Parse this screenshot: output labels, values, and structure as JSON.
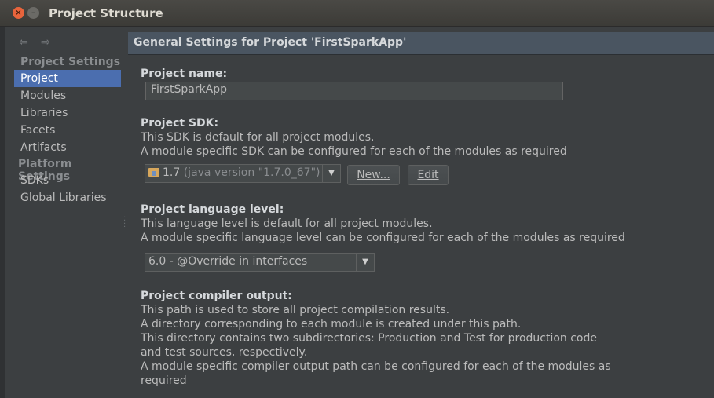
{
  "window": {
    "title": "Project Structure",
    "close_glyph": "×",
    "maximize_glyph": "–"
  },
  "sidebar": {
    "back_arrow": "⇦",
    "forward_arrow": "⇨",
    "section_project": "Project Settings",
    "items_project": [
      {
        "label": "Project",
        "selected": true
      },
      {
        "label": "Modules"
      },
      {
        "label": "Libraries"
      },
      {
        "label": "Facets"
      },
      {
        "label": "Artifacts"
      }
    ],
    "section_platform": "Platform Settings",
    "items_platform": [
      {
        "label": "SDKs"
      },
      {
        "label": "Global Libraries"
      }
    ]
  },
  "main": {
    "header": "General Settings for Project 'FirstSparkApp'",
    "project_name": {
      "label": "Project name:",
      "value": "FirstSparkApp"
    },
    "project_sdk": {
      "label": "Project SDK:",
      "desc1": "This SDK is default for all project modules.",
      "desc2": "A module specific SDK can be configured for each of the modules as required",
      "selected_version": "1.7",
      "selected_detail": "(java version \"1.7.0_67\")",
      "new_button": "New...",
      "edit_button": "Edit"
    },
    "language_level": {
      "label": "Project language level:",
      "desc1": "This language level is default for all project modules.",
      "desc2": "A module specific language level can be configured for each of the modules as required",
      "selected": "6.0 - @Override in interfaces"
    },
    "compiler_output": {
      "label": "Project compiler output:",
      "desc1": "This path is used to store all project compilation results.",
      "desc2": "A directory corresponding to each module is created under this path.",
      "desc3": "This directory contains two subdirectories: Production and Test for production code",
      "desc4": "and test sources, respectively.",
      "desc5": "A module specific compiler output path can be configured for each of the modules as",
      "desc6": "required"
    }
  },
  "colors": {
    "selection": "#4b6eaf",
    "background": "#3c3f41",
    "header": "#4a5561"
  }
}
